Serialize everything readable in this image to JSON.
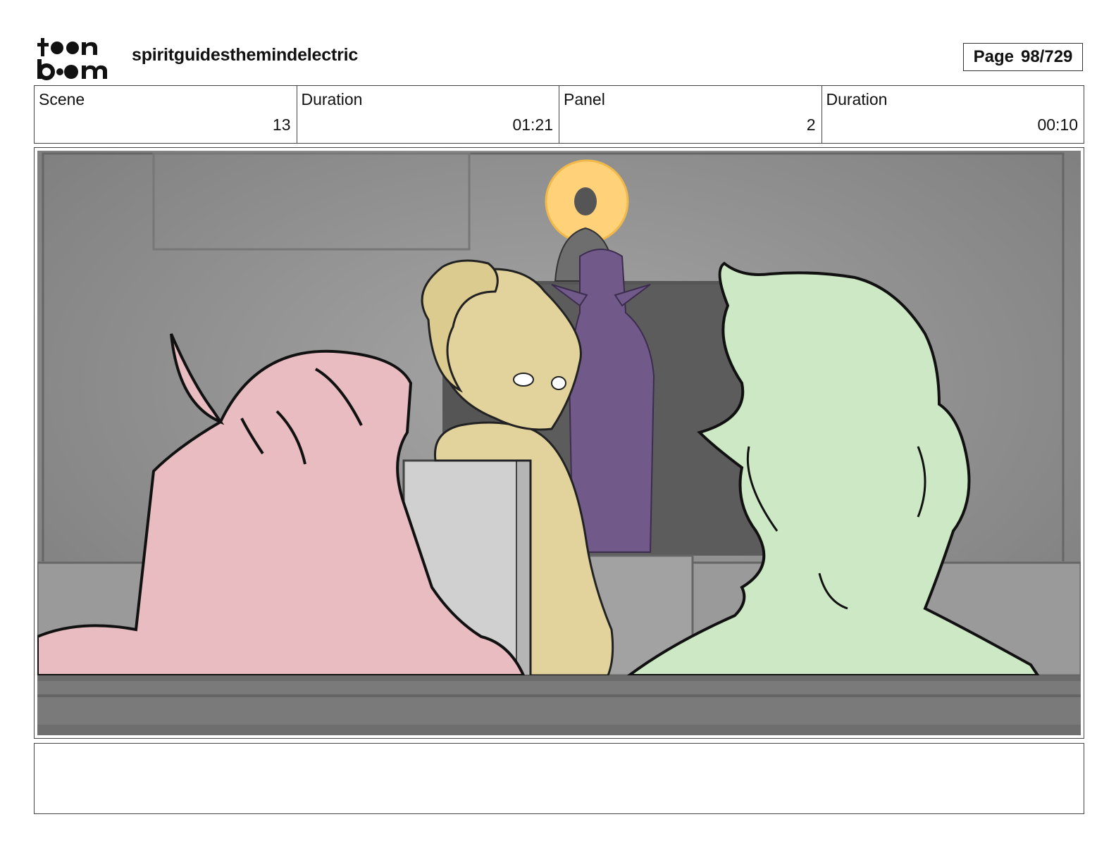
{
  "header": {
    "logo_text_line1": "toon",
    "logo_text_line2": "boom",
    "project_title": "spiritguidesthemindelectric",
    "page_label": "Page",
    "page_value": "98/729"
  },
  "info": {
    "scene_label": "Scene",
    "scene_value": "13",
    "scene_duration_label": "Duration",
    "scene_duration_value": "01:21",
    "panel_label": "Panel",
    "panel_value": "2",
    "panel_duration_label": "Duration",
    "panel_duration_value": "00:10"
  },
  "panel": {
    "image_description_icon": "storyboard-drawing"
  },
  "notes": {
    "text": ""
  }
}
